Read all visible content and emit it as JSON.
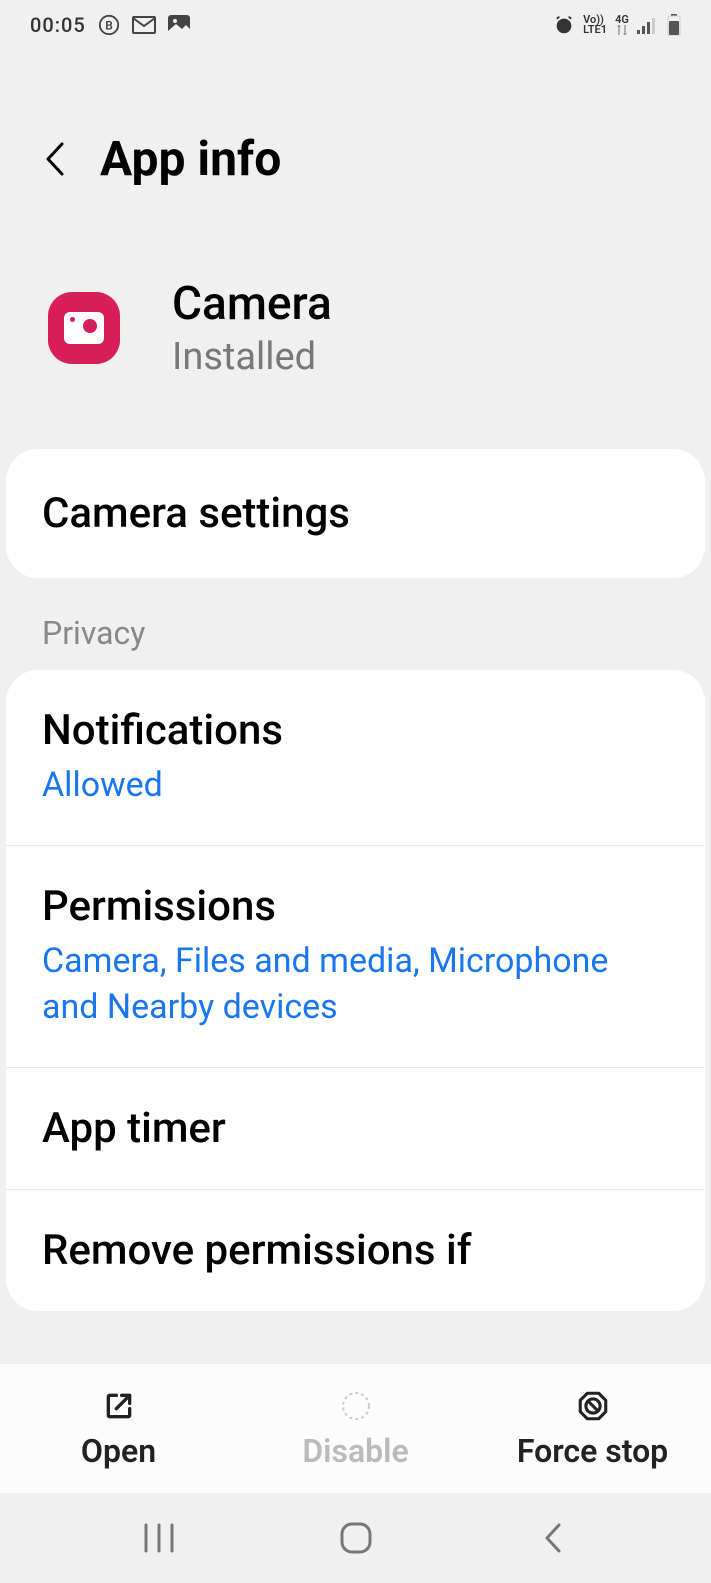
{
  "status_bar": {
    "time": "00:05",
    "network_label_top": "Vo))",
    "network_label_bottom": "LTE1",
    "data_type": "4G"
  },
  "header": {
    "title": "App info"
  },
  "app": {
    "name": "Camera",
    "status": "Installed"
  },
  "settings_link": {
    "label": "Camera settings"
  },
  "privacy_section": {
    "label": "Privacy",
    "items": {
      "notifications": {
        "title": "Notifications",
        "subtitle": "Allowed"
      },
      "permissions": {
        "title": "Permissions",
        "subtitle": "Camera, Files and media, Microphone and Nearby devices"
      },
      "app_timer": {
        "title": "App timer"
      },
      "remove_permissions": {
        "title": "Remove permissions if"
      }
    }
  },
  "actions": {
    "open": "Open",
    "disable": "Disable",
    "force_stop": "Force stop"
  }
}
